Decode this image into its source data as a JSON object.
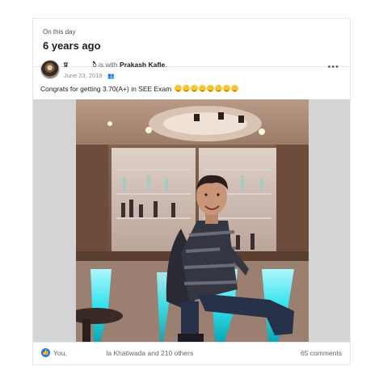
{
  "memory": {
    "kicker": "On this day",
    "title": "6 years ago"
  },
  "post": {
    "author_initial": "प्र",
    "author_suffix": "ै",
    "with_text": "is with",
    "tagged": "Prakash Kafle",
    "period": ".",
    "date": "June 23, 2018",
    "separator": "·",
    "audience_icon": "friends-icon",
    "caption": "Congrats for getting 3.70(A+) in  SEE Exam",
    "emoji_count": 8
  },
  "reactions": {
    "icon": "like-icon",
    "you": "You,",
    "others": "la Khatiwada and 210 others",
    "comments": "65 comments"
  },
  "colors": {
    "like": "#1877f2",
    "border": "#e4e6eb",
    "neon": "#33e3ee"
  }
}
